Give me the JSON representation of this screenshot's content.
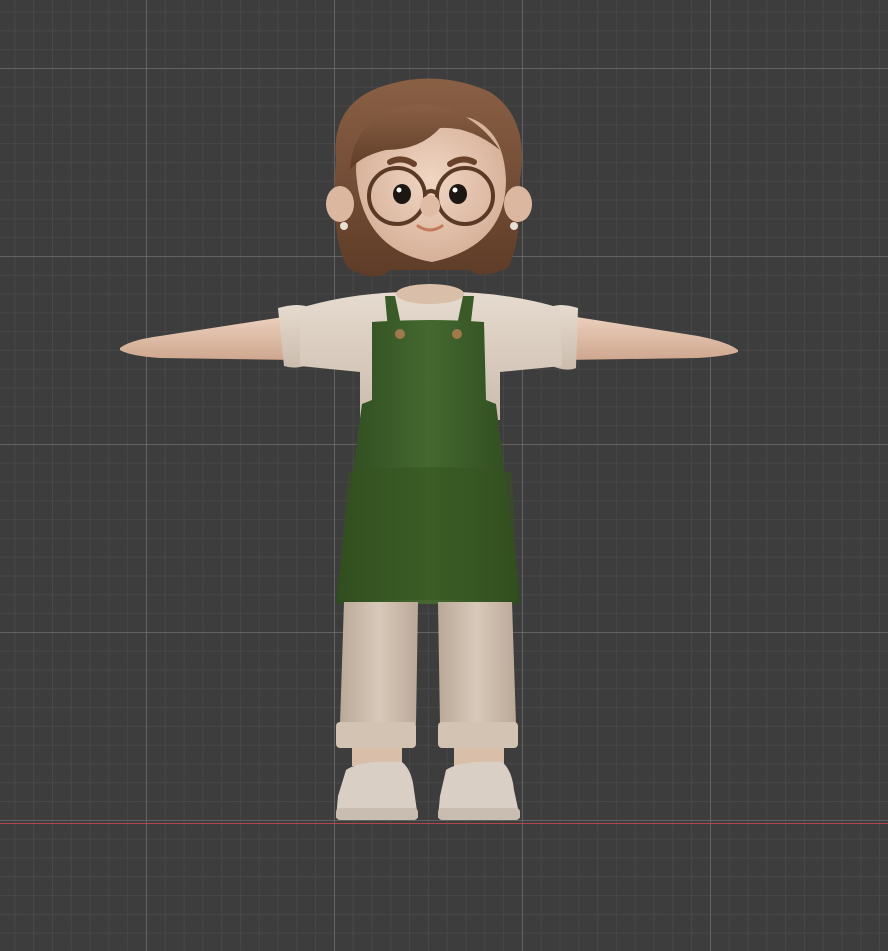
{
  "viewport": {
    "mode": "3d-viewport",
    "grid": true,
    "background_color": "#3d3d3d",
    "x_axis_color": "#b0474f"
  },
  "model": {
    "pose": "T-pose",
    "colors": {
      "hair": "#7a5236",
      "skin": "#ddb9a1",
      "shirt": "#ddd0c2",
      "apron": "#3d5f2a",
      "pants": "#cfc0b0",
      "shoes": "#d8cdc2",
      "glasses": "#5a3a26",
      "buttons": "#a07a4a"
    }
  }
}
